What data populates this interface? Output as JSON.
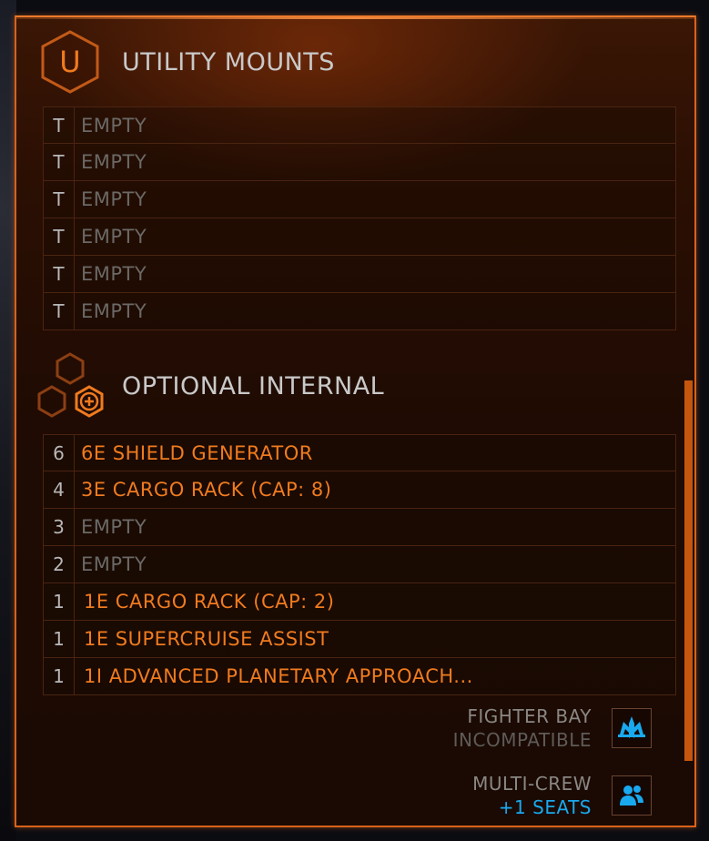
{
  "utility": {
    "badge_letter": "U",
    "title": "UTILITY MOUNTS",
    "slots": [
      {
        "size": "T",
        "name": "EMPTY"
      },
      {
        "size": "T",
        "name": "EMPTY"
      },
      {
        "size": "T",
        "name": "EMPTY"
      },
      {
        "size": "T",
        "name": "EMPTY"
      },
      {
        "size": "T",
        "name": "EMPTY"
      },
      {
        "size": "T",
        "name": "EMPTY"
      }
    ]
  },
  "optional": {
    "title": "OPTIONAL INTERNAL",
    "slots": [
      {
        "size": "6",
        "name": "6E SHIELD GENERATOR",
        "state": "filled"
      },
      {
        "size": "4",
        "name": "3E CARGO RACK (CAP: 8)",
        "state": "filled"
      },
      {
        "size": "3",
        "name": "EMPTY",
        "state": "empty"
      },
      {
        "size": "2",
        "name": "EMPTY",
        "state": "empty"
      },
      {
        "size": "1",
        "name": "1E CARGO RACK (CAP: 2)",
        "state": "filled"
      },
      {
        "size": "1",
        "name": "1E SUPERCRUISE ASSIST",
        "state": "filled"
      },
      {
        "size": "1",
        "name": "1I ADVANCED PLANETARY APPROACH...",
        "state": "filled"
      }
    ]
  },
  "abilities": {
    "fighter_bay": {
      "label": "FIGHTER BAY",
      "status": "INCOMPATIBLE",
      "icon": "fighter-icon"
    },
    "multi_crew": {
      "label": "MULTI-CREW",
      "status": "+1 SEATS",
      "icon": "crew-icon"
    }
  },
  "colors": {
    "accent_orange": "#f07b1f",
    "border_orange": "#d9621a",
    "empty_gray": "#6b6966",
    "info_blue": "#19a9ef"
  }
}
